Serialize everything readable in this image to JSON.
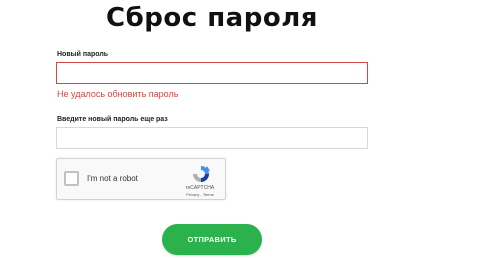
{
  "page": {
    "title": "Сброс пароля"
  },
  "form": {
    "new_password_label": "Новый пароль",
    "new_password_value": "",
    "error_message": "Не удалось обновить пароль",
    "confirm_password_label": "Введите новый пароль еще раз",
    "confirm_password_value": "",
    "submit_label": "ОТПРАВИТЬ"
  },
  "recaptcha": {
    "checkbox_label": "I'm not a robot",
    "brand": "reCAPTCHA",
    "links": "Privacy - Terms",
    "checked": false
  },
  "colors": {
    "accent": "#2bb24c",
    "error": "#d14848",
    "input_border": "#d9d9d9"
  }
}
